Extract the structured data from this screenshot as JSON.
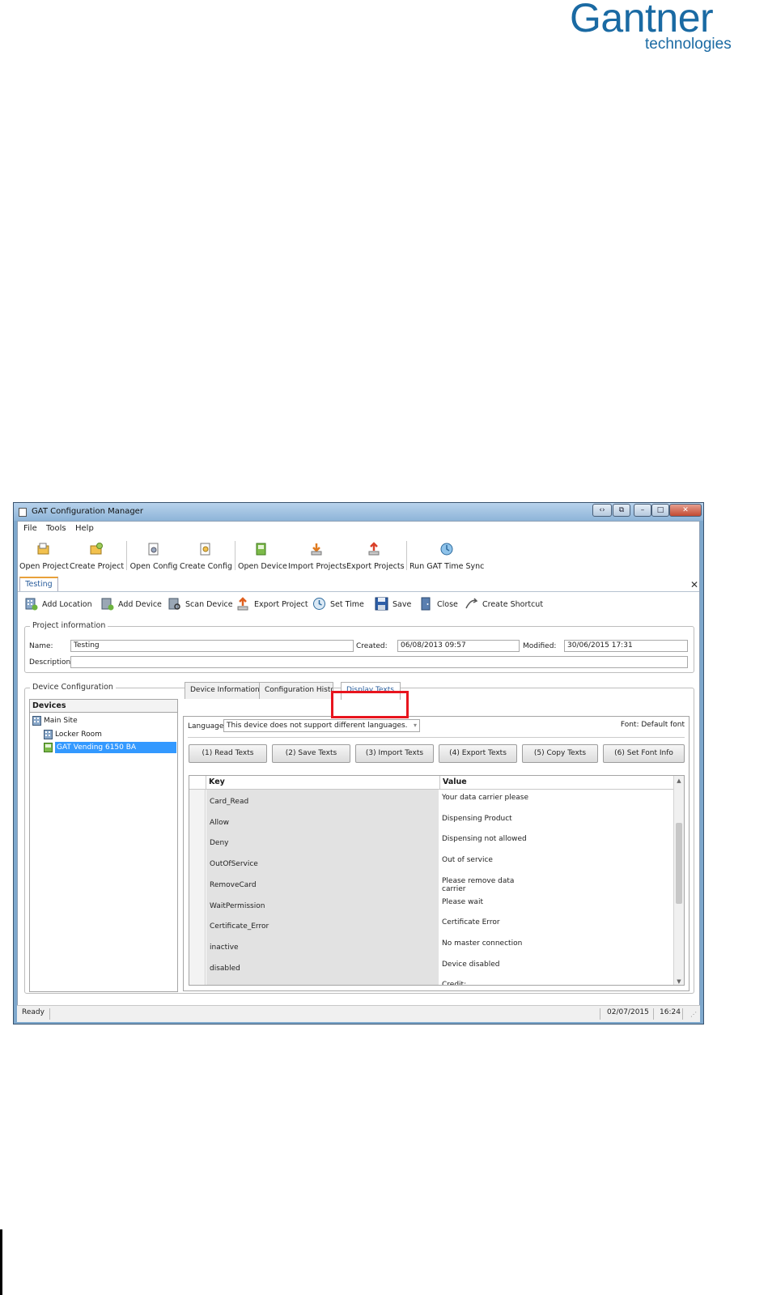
{
  "logo": {
    "main": "Gantner",
    "sub": "technologies"
  },
  "window": {
    "title": "GAT Configuration Manager"
  },
  "menu": [
    "File",
    "Tools",
    "Help"
  ],
  "main_toolbar": [
    {
      "label": "Open Project",
      "icon": "open-project-icon"
    },
    {
      "label": "Create Project",
      "icon": "create-project-icon"
    },
    {
      "label": "Open Config",
      "icon": "open-config-icon"
    },
    {
      "label": "Create Config",
      "icon": "create-config-icon"
    },
    {
      "label": "Open Device",
      "icon": "open-device-icon"
    },
    {
      "label": "Import Projects",
      "icon": "import-projects-icon"
    },
    {
      "label": "Export Projects",
      "icon": "export-projects-icon"
    },
    {
      "label": "Run GAT Time Sync",
      "icon": "time-sync-icon"
    }
  ],
  "document_tab": "Testing",
  "sub_toolbar": [
    {
      "label": "Add Location",
      "icon": "add-location-icon"
    },
    {
      "label": "Add Device",
      "icon": "add-device-icon"
    },
    {
      "label": "Scan Device",
      "icon": "scan-device-icon"
    },
    {
      "label": "Export Project",
      "icon": "export-project-icon"
    },
    {
      "label": "Set Time",
      "icon": "set-time-icon"
    },
    {
      "label": "Save",
      "icon": "save-icon"
    },
    {
      "label": "Close",
      "icon": "close-door-icon"
    },
    {
      "label": "Create Shortcut",
      "icon": "shortcut-icon"
    }
  ],
  "project_info": {
    "legend": "Project information",
    "name_label": "Name:",
    "name_value": "Testing",
    "created_label": "Created:",
    "created_value": "06/08/2013 09:57",
    "modified_label": "Modified:",
    "modified_value": "30/06/2015 17:31",
    "description_label": "Description:",
    "description_value": ""
  },
  "device_config": {
    "legend": "Device Configuration",
    "devices_header": "Devices",
    "tree": [
      {
        "label": "Main Site",
        "level": 0,
        "icon": "site-icon",
        "selected": false
      },
      {
        "label": "Locker Room",
        "level": 1,
        "icon": "location-icon",
        "selected": false
      },
      {
        "label": "GAT Vending 6150 BA",
        "level": 1,
        "icon": "device-icon",
        "selected": true
      }
    ],
    "tabs": [
      "Device Information",
      "Configuration History",
      "Display Texts"
    ],
    "active_tab": "Display Texts",
    "language_label": "Language",
    "language_value": "This device does not support different languages.",
    "font_info": "Font: Default font",
    "actions": [
      "(1) Read Texts",
      "(2) Save Texts",
      "(3) Import Texts",
      "(4) Export Texts",
      "(5) Copy Texts",
      "(6) Set Font Info"
    ],
    "grid_headers": {
      "key": "Key",
      "value": "Value"
    },
    "rows": [
      {
        "key": "Card_Read",
        "value": "Your data carrier please"
      },
      {
        "key": "Allow",
        "value": "Dispensing Product"
      },
      {
        "key": "Deny",
        "value": "Dispensing not allowed"
      },
      {
        "key": "OutOfService",
        "value": "Out of service"
      },
      {
        "key": "RemoveCard",
        "value": "Please remove data carrier"
      },
      {
        "key": "WaitPermission",
        "value": "Please wait"
      },
      {
        "key": "Certificate_Error",
        "value": "Certificate Error"
      },
      {
        "key": "inactive",
        "value": "No master connection"
      },
      {
        "key": "disabled",
        "value": "Device disabled"
      },
      {
        "key": "",
        "value": "Credit:"
      }
    ]
  },
  "status": {
    "text": "Ready",
    "date": "02/07/2015",
    "time": "16:24"
  },
  "colors": {
    "brand": "#1a6aa3",
    "highlight": "#e8151e",
    "selection": "#3399ff"
  }
}
